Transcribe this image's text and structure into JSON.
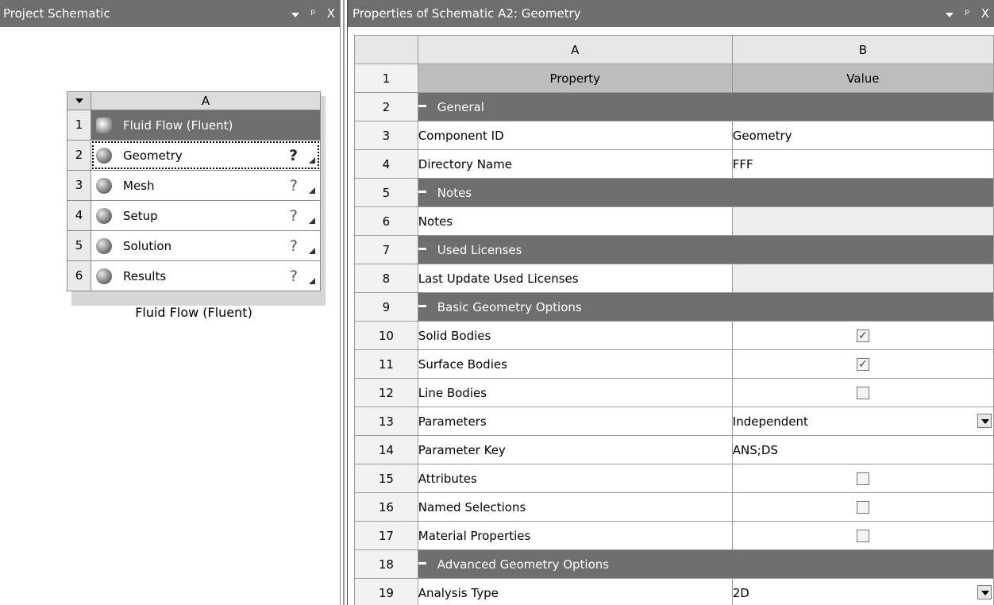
{
  "left_pane": {
    "title": "Project Schematic",
    "controls": {
      "dropdown": "▼",
      "pin": "ᵖ",
      "close": "X"
    }
  },
  "system": {
    "column_header": "A",
    "rows": [
      {
        "num": "1",
        "label": "Fluid Flow (Fluent)",
        "icon": "fluid-flow-icon",
        "status": ""
      },
      {
        "num": "2",
        "label": "Geometry",
        "icon": "geometry-icon",
        "status": "?"
      },
      {
        "num": "3",
        "label": "Mesh",
        "icon": "mesh-icon",
        "status": "?"
      },
      {
        "num": "4",
        "label": "Setup",
        "icon": "setup-icon",
        "status": "?"
      },
      {
        "num": "5",
        "label": "Solution",
        "icon": "solution-icon",
        "status": "?"
      },
      {
        "num": "6",
        "label": "Results",
        "icon": "results-icon",
        "status": "?"
      }
    ],
    "caption": "Fluid Flow (Fluent)"
  },
  "right_pane": {
    "title": "Properties of Schematic A2: Geometry",
    "col_a": "A",
    "col_b": "B",
    "rows": [
      {
        "num": "1",
        "type": "header",
        "name": "Property",
        "value": "Value"
      },
      {
        "num": "2",
        "type": "group",
        "name": "General"
      },
      {
        "num": "3",
        "type": "text",
        "name": "Component ID",
        "value": "Geometry"
      },
      {
        "num": "4",
        "type": "text",
        "name": "Directory Name",
        "value": "FFF"
      },
      {
        "num": "5",
        "type": "group",
        "name": "Notes"
      },
      {
        "num": "6",
        "type": "empty",
        "name": "Notes",
        "value": ""
      },
      {
        "num": "7",
        "type": "group",
        "name": "Used Licenses"
      },
      {
        "num": "8",
        "type": "empty",
        "name": "Last Update Used Licenses",
        "value": ""
      },
      {
        "num": "9",
        "type": "group",
        "name": "Basic Geometry Options"
      },
      {
        "num": "10",
        "type": "check",
        "name": "Solid Bodies",
        "checked": true
      },
      {
        "num": "11",
        "type": "check",
        "name": "Surface Bodies",
        "checked": true
      },
      {
        "num": "12",
        "type": "check",
        "name": "Line Bodies",
        "checked": false
      },
      {
        "num": "13",
        "type": "select",
        "name": "Parameters",
        "value": "Independent"
      },
      {
        "num": "14",
        "type": "text",
        "name": "Parameter Key",
        "value": "ANS;DS"
      },
      {
        "num": "15",
        "type": "check",
        "name": "Attributes",
        "checked": false
      },
      {
        "num": "16",
        "type": "check",
        "name": "Named Selections",
        "checked": false
      },
      {
        "num": "17",
        "type": "check",
        "name": "Material Properties",
        "checked": false
      },
      {
        "num": "18",
        "type": "group",
        "name": "Advanced Geometry Options"
      },
      {
        "num": "19",
        "type": "select",
        "name": "Analysis Type",
        "value": "2D"
      }
    ]
  },
  "colors": {
    "header_bg": "#6e6e6e",
    "group_bg": "#6e6e6e",
    "prop_header_bg": "#bdbdbd"
  }
}
